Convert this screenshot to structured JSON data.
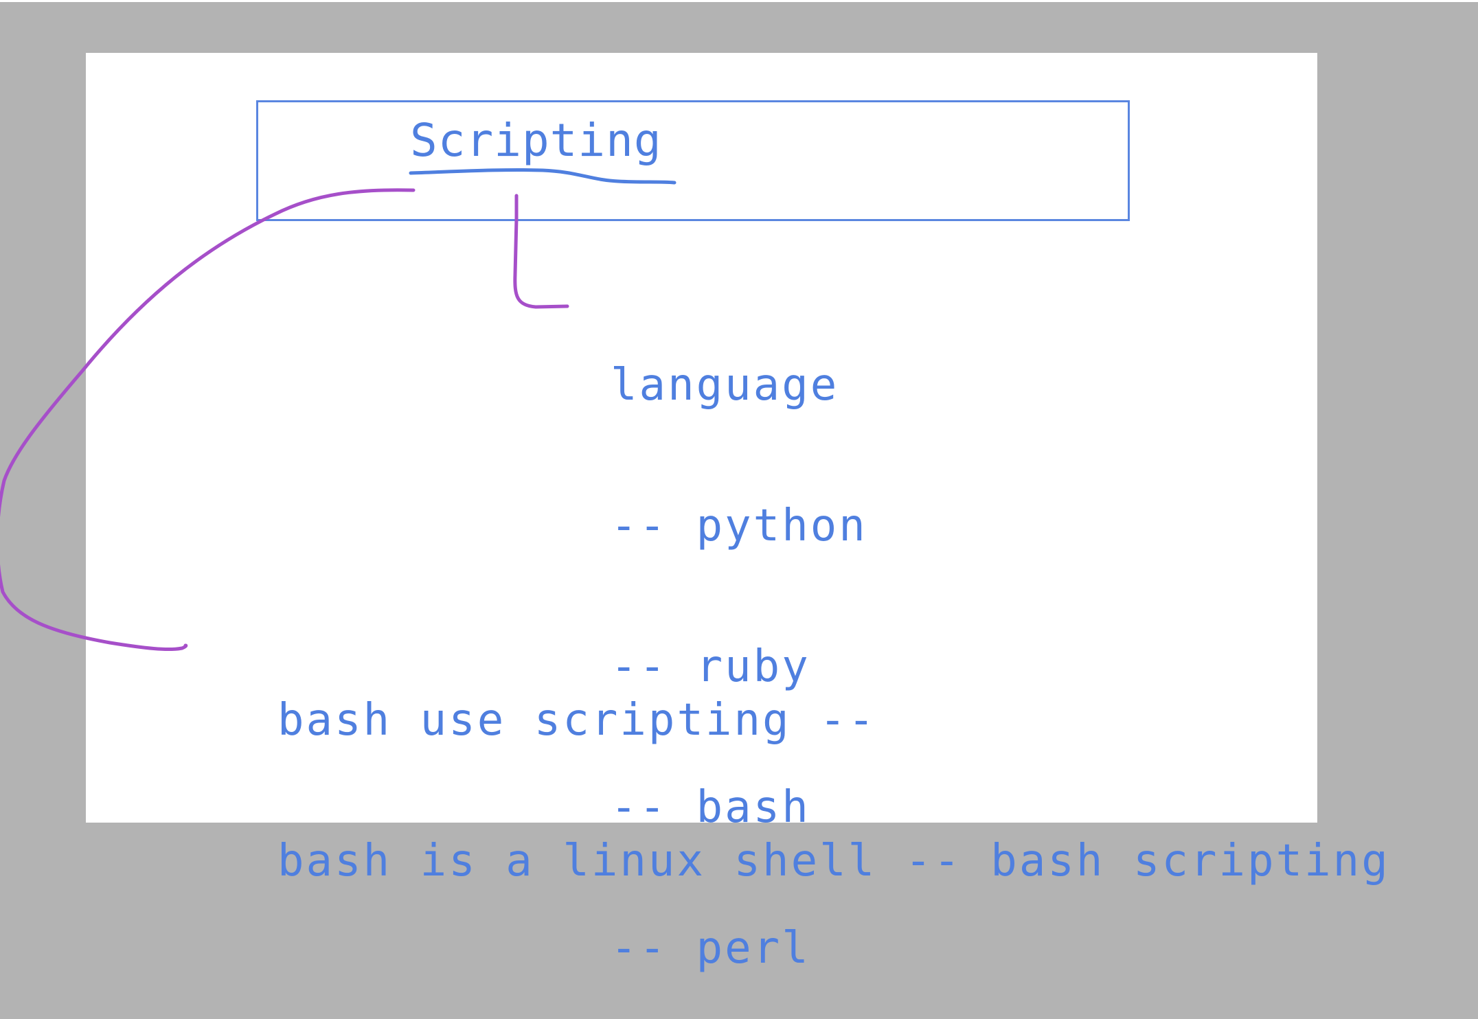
{
  "board": {
    "title": "Scripting",
    "language_list": [
      "language",
      "-- python",
      "-- ruby",
      "-- bash",
      "-- perl"
    ],
    "notes": [
      "bash use scripting --",
      "bash is a linux shell -- bash scripting"
    ]
  },
  "colors": {
    "background": "#b3b3b3",
    "page": "#ffffff",
    "text_blue": "#4f7fdf",
    "box_blue": "#5a86e0",
    "ink_purple": "#a64fc9"
  }
}
